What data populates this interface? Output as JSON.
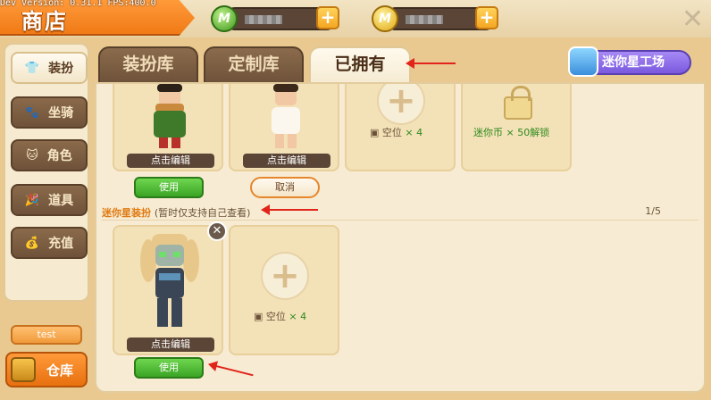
{
  "header": {
    "dev_text": "Dev Version: 0.31.1   FPS:400.0",
    "title": "商店",
    "currency_green_letter": "M",
    "currency_gold_letter": "M",
    "plus": "+",
    "close": "✕"
  },
  "sidebar": {
    "items": [
      {
        "label": "装扮",
        "icon": "👕"
      },
      {
        "label": "坐骑",
        "icon": "🐾"
      },
      {
        "label": "角色",
        "icon": "🐱"
      },
      {
        "label": "道具",
        "icon": "🎉"
      },
      {
        "label": "充值",
        "icon": "💰"
      }
    ],
    "test_label": "test",
    "warehouse_label": "仓库"
  },
  "tabs": [
    {
      "label": "装扮库"
    },
    {
      "label": "定制库"
    },
    {
      "label": "已拥有"
    }
  ],
  "workshop_label": "迷你星工场",
  "top_row": {
    "card1_edit": "点击编辑",
    "card1_use": "使用",
    "card2_edit": "点击编辑",
    "card2_cancel": "取消",
    "slot_label": "空位",
    "slot_count": "× 4",
    "lock_text": "迷你币 × 50解锁"
  },
  "section": {
    "title": "迷你星装扮",
    "subtitle": "(暂时仅支持自己查看)",
    "page": "1/5"
  },
  "bottom_row": {
    "card1_edit": "点击编辑",
    "card1_use": "使用",
    "slot_label": "空位",
    "slot_count": "× 4",
    "remove": "✕"
  },
  "colors": {
    "accent_orange": "#f07a16",
    "use_green": "#3aa425",
    "workshop_purple": "#7a59de",
    "annotation_red": "#e2231a"
  }
}
